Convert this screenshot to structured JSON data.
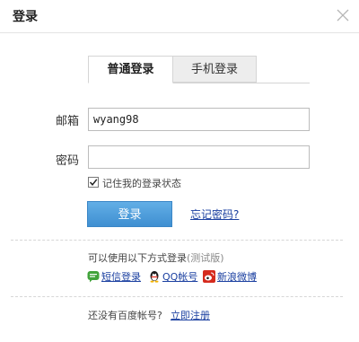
{
  "dialog": {
    "title": "登录"
  },
  "tabs": [
    {
      "label": "普通登录"
    },
    {
      "label": "手机登录"
    }
  ],
  "form": {
    "email_label": "邮箱",
    "email_value": "wyang98",
    "password_label": "密码",
    "password_value": "",
    "remember_label": "记住我的登录状态",
    "remember_checked": true,
    "login_button": "登录",
    "forgot_link": "忘记密码?"
  },
  "alt_login": {
    "title": "可以使用以下方式登录",
    "beta_note": "(测试版)",
    "options": [
      {
        "label": "短信登录",
        "icon": "sms-icon",
        "color": "#41a33a"
      },
      {
        "label": "QQ帐号",
        "icon": "qq-icon",
        "color": "#1a1a1a"
      },
      {
        "label": "新浪微博",
        "icon": "weibo-icon",
        "color": "#d52b1e"
      }
    ]
  },
  "footer": {
    "no_account": "还没有百度帐号?",
    "register_link": "立即注册"
  }
}
